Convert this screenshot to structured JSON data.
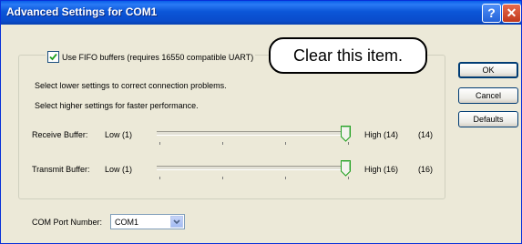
{
  "window": {
    "title": "Advanced Settings for COM1",
    "help_glyph": "?",
    "close_glyph": "✕"
  },
  "fifo": {
    "checkbox_label": "Use FIFO buffers (requires 16550 compatible UART)",
    "checked": true
  },
  "callout": "Clear this item.",
  "hints": {
    "lower": "Select lower settings to correct connection problems.",
    "higher": "Select higher settings for faster performance."
  },
  "receive": {
    "label": "Receive Buffer:",
    "low": "Low (1)",
    "high": "High (14)",
    "value": "(14)",
    "level": 1.0
  },
  "transmit": {
    "label": "Transmit Buffer:",
    "low": "Low (1)",
    "high": "High (16)",
    "value": "(16)",
    "level": 1.0
  },
  "buttons": {
    "ok": "OK",
    "cancel": "Cancel",
    "defaults": "Defaults"
  },
  "com_port": {
    "label": "COM Port Number:",
    "selected": "COM1"
  }
}
